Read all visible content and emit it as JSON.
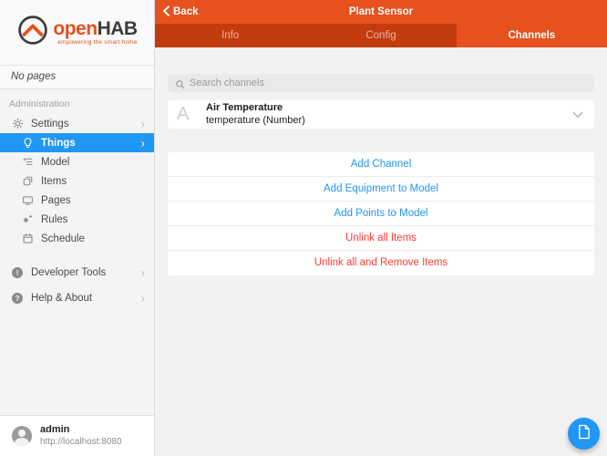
{
  "sidebar": {
    "logo": {
      "brand_open": "open",
      "brand_hab": "HAB",
      "tagline": "empowering the smart home"
    },
    "no_pages": "No pages",
    "section_label": "Administration",
    "items": [
      {
        "label": "Settings",
        "icon": "gear-icon",
        "selected": false
      },
      {
        "label": "Things",
        "icon": "lightbulb-icon",
        "selected": true
      },
      {
        "label": "Model",
        "icon": "list-tree-icon",
        "selected": false
      },
      {
        "label": "Items",
        "icon": "squares-icon",
        "selected": false
      },
      {
        "label": "Pages",
        "icon": "monitor-icon",
        "selected": false
      },
      {
        "label": "Rules",
        "icon": "sparkle-icon",
        "selected": false
      },
      {
        "label": "Schedule",
        "icon": "calendar-icon",
        "selected": false
      }
    ],
    "tools": [
      {
        "label": "Developer Tools",
        "icon": "exclamation-circle-icon",
        "glyph": "!"
      },
      {
        "label": "Help & About",
        "icon": "question-circle-icon",
        "glyph": "?"
      }
    ],
    "user": {
      "name": "admin",
      "url": "http://localhost:8080"
    }
  },
  "header": {
    "back_label": "Back",
    "title": "Plant Sensor",
    "tabs": [
      {
        "label": "Info",
        "selected": false
      },
      {
        "label": "Config",
        "selected": false
      },
      {
        "label": "Channels",
        "selected": true
      }
    ]
  },
  "main": {
    "search": {
      "placeholder": "Search channels"
    },
    "group_letter": "A",
    "channel": {
      "title": "Air Temperature",
      "subtitle": "temperature (Number)"
    },
    "actions": [
      {
        "label": "Add Channel",
        "color": "blue"
      },
      {
        "label": "Add Equipment to Model",
        "color": "blue"
      },
      {
        "label": "Add Points to Model",
        "color": "blue"
      },
      {
        "label": "Unlink all Items",
        "color": "red"
      },
      {
        "label": "Unlink all and Remove Items",
        "color": "red"
      }
    ]
  },
  "colors": {
    "accent_orange": "#e6511e",
    "tab_inactive_bg": "#c23c10",
    "selected_blue": "#2196f3",
    "link_blue": "#2196f3",
    "danger_red": "#ff3b30"
  }
}
